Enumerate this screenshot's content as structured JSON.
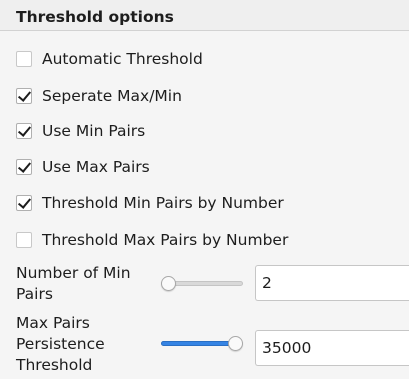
{
  "section": {
    "title": "Threshold options"
  },
  "checkboxes": [
    {
      "label": "Automatic Threshold",
      "checked": false
    },
    {
      "label": "Seperate Max/Min",
      "checked": true
    },
    {
      "label": "Use Min Pairs",
      "checked": true
    },
    {
      "label": "Use Max Pairs",
      "checked": true
    },
    {
      "label": "Threshold Min Pairs by Number",
      "checked": true
    },
    {
      "label": "Threshold Max Pairs by Number",
      "checked": false
    }
  ],
  "min_pairs": {
    "label": "Number of Min Pairs",
    "slider_level": 0.0,
    "value": "2"
  },
  "max_pairs_threshold": {
    "label": "Max Pairs Persistence Threshold",
    "slider_level": 1.0,
    "value": "35000"
  },
  "colors": {
    "accent": "#3584e4",
    "background": "#f5f5f5",
    "header_background": "#efefef"
  }
}
